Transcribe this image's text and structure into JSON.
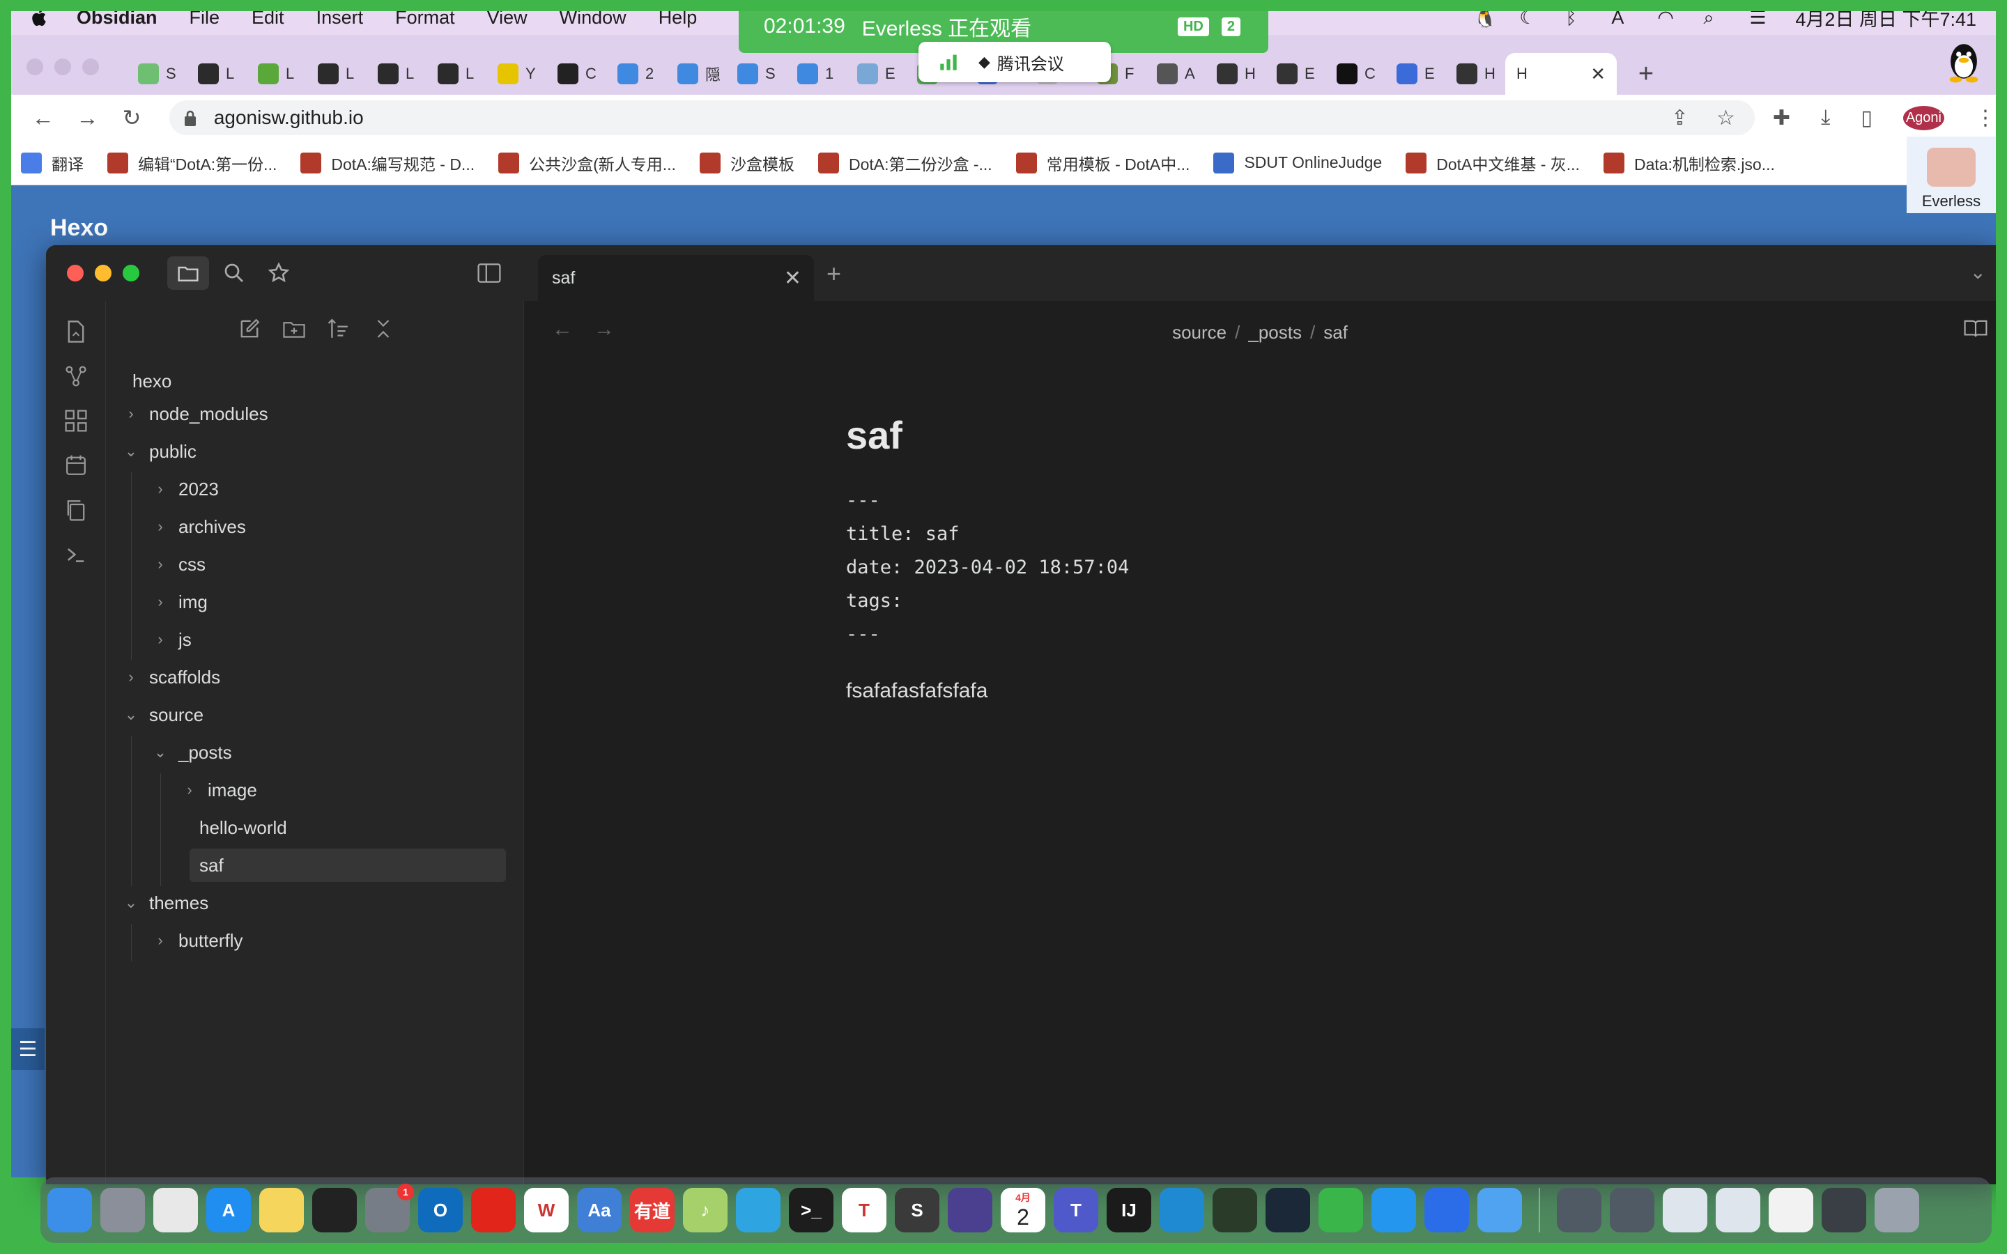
{
  "menubar": {
    "app_name": "Obsidian",
    "items": [
      "File",
      "Edit",
      "Insert",
      "Format",
      "View",
      "Window",
      "Help"
    ],
    "clock": "4月2日 周日 下午7:41"
  },
  "meeting": {
    "timer": "02:01:39",
    "watching": "Everless 正在观看",
    "hd": "HD",
    "people": "2",
    "app_label": "腾讯会议"
  },
  "browser": {
    "active_tab_label": "H",
    "url": "agonisw.github.io",
    "profile_name": "Agoni",
    "side_user_name": "Everless",
    "tab_letters": [
      "S",
      "L",
      "L",
      "L",
      "L",
      "L",
      "Y",
      "C",
      "2",
      "隠",
      "S",
      "1",
      "E",
      "3",
      "\\",
      "F",
      "F",
      "A",
      "H",
      "E",
      "C",
      "E",
      "H"
    ],
    "bookmarks": [
      {
        "label": "翻译",
        "color": "#4a7de8"
      },
      {
        "label": "编辑“DotA:第一份...",
        "color": "#b23a2a"
      },
      {
        "label": "DotA:编写规范 - D...",
        "color": "#b23a2a"
      },
      {
        "label": "公共沙盒(新人专用...",
        "color": "#b23a2a"
      },
      {
        "label": "沙盒模板",
        "color": "#b23a2a"
      },
      {
        "label": "DotA:第二份沙盒 -...",
        "color": "#b23a2a"
      },
      {
        "label": "常用模板 - DotA中...",
        "color": "#b23a2a"
      },
      {
        "label": "SDUT OnlineJudge",
        "color": "#3a6bc9"
      },
      {
        "label": "DotA中文维基 - 灰...",
        "color": "#b23a2a"
      },
      {
        "label": "Data:机制检索.jso...",
        "color": "#b23a2a"
      }
    ]
  },
  "webpage": {
    "site_title": "Hexo"
  },
  "obsidian": {
    "tab_title": "saf",
    "breadcrumb": [
      "source",
      "_posts",
      "saf"
    ],
    "vault_name": "hexo",
    "tree": [
      {
        "label": "node_modules",
        "depth": 0,
        "expanded": false
      },
      {
        "label": "public",
        "depth": 0,
        "expanded": true
      },
      {
        "label": "2023",
        "depth": 1,
        "expanded": false
      },
      {
        "label": "archives",
        "depth": 1,
        "expanded": false
      },
      {
        "label": "css",
        "depth": 1,
        "expanded": false
      },
      {
        "label": "img",
        "depth": 1,
        "expanded": false
      },
      {
        "label": "js",
        "depth": 1,
        "expanded": false
      },
      {
        "label": "scaffolds",
        "depth": 0,
        "expanded": false
      },
      {
        "label": "source",
        "depth": 0,
        "expanded": true
      },
      {
        "label": "_posts",
        "depth": 1,
        "expanded": true
      },
      {
        "label": "image",
        "depth": 2,
        "expanded": false
      },
      {
        "label": "hello-world",
        "depth": 2,
        "file": true
      },
      {
        "label": "saf",
        "depth": 2,
        "file": true,
        "selected": true
      },
      {
        "label": "themes",
        "depth": 0,
        "expanded": true
      },
      {
        "label": "butterfly",
        "depth": 1,
        "expanded": false
      }
    ],
    "note": {
      "title": "saf",
      "frontmatter": [
        "---",
        "title: saf",
        "date: 2023-04-02 18:57:04",
        "tags:",
        "---"
      ],
      "body": "fsafafasfafsfafa"
    }
  },
  "dock": {
    "badge_count": "1",
    "calendar_month": "4月",
    "calendar_day": "2",
    "apps": [
      {
        "name": "finder",
        "color": "#3b8fe8",
        "glyph": ""
      },
      {
        "name": "launchpad",
        "color": "#8a8f99",
        "glyph": ""
      },
      {
        "name": "chrome",
        "color": "#e8e8e8",
        "glyph": ""
      },
      {
        "name": "app-store",
        "color": "#1f8ef0",
        "glyph": "A"
      },
      {
        "name": "notes",
        "color": "#f6d55c",
        "glyph": ""
      },
      {
        "name": "qq",
        "color": "#222222",
        "glyph": ""
      },
      {
        "name": "system-preferences",
        "color": "#777d86",
        "glyph": ""
      },
      {
        "name": "outlook",
        "color": "#0f6cbd",
        "glyph": "O"
      },
      {
        "name": "netease-music",
        "color": "#e1251b",
        "glyph": ""
      },
      {
        "name": "wps",
        "color": "#ffffff",
        "glyph": "W"
      },
      {
        "name": "dictionary",
        "color": "#3f7fd6",
        "glyph": "Aa"
      },
      {
        "name": "youdao",
        "color": "#e53935",
        "glyph": "有道"
      },
      {
        "name": "music",
        "color": "#a6d16a",
        "glyph": "♪"
      },
      {
        "name": "telegram",
        "color": "#2ea4e0",
        "glyph": ""
      },
      {
        "name": "terminal",
        "color": "#1d1d1d",
        "glyph": ">_"
      },
      {
        "name": "typora",
        "color": "#ffffff",
        "glyph": "T"
      },
      {
        "name": "sublime",
        "color": "#3a3a3a",
        "glyph": "S"
      },
      {
        "name": "obsidian",
        "color": "#4b3f8f",
        "glyph": ""
      },
      {
        "name": "calendar",
        "color": "#ffffff",
        "glyph": ""
      },
      {
        "name": "teams",
        "color": "#5059c9",
        "glyph": "T"
      },
      {
        "name": "intellij",
        "color": "#1b1b1b",
        "glyph": "IJ"
      },
      {
        "name": "vscode",
        "color": "#1f8ad2",
        "glyph": ""
      },
      {
        "name": "clash",
        "color": "#2a3b2a",
        "glyph": ""
      },
      {
        "name": "steam",
        "color": "#1b2838",
        "glyph": ""
      },
      {
        "name": "evernote",
        "color": "#3ab54a",
        "glyph": ""
      },
      {
        "name": "docker",
        "color": "#2496ed",
        "glyph": ""
      },
      {
        "name": "tencent-meeting",
        "color": "#2b6de8",
        "glyph": ""
      },
      {
        "name": "xcode",
        "color": "#4fa3f0",
        "glyph": ""
      },
      {
        "name": "recent-window-1",
        "color": "#505a64",
        "glyph": ""
      },
      {
        "name": "recent-window-2",
        "color": "#505a64",
        "glyph": ""
      },
      {
        "name": "recent-window-3",
        "color": "#dfe5ec",
        "glyph": ""
      },
      {
        "name": "recent-window-4",
        "color": "#dfe5ec",
        "glyph": ""
      },
      {
        "name": "recent-window-5",
        "color": "#f2f2f2",
        "glyph": ""
      },
      {
        "name": "recent-window-6",
        "color": "#3a3f46",
        "glyph": ""
      },
      {
        "name": "trash",
        "color": "#9aa3ad",
        "glyph": ""
      }
    ]
  },
  "colors": {
    "frame_green": "#3fb54a",
    "obsidian_bg": "#1e1e1e",
    "obsidian_sidebar": "#262626",
    "hexo_blue": "#3e74b8"
  }
}
